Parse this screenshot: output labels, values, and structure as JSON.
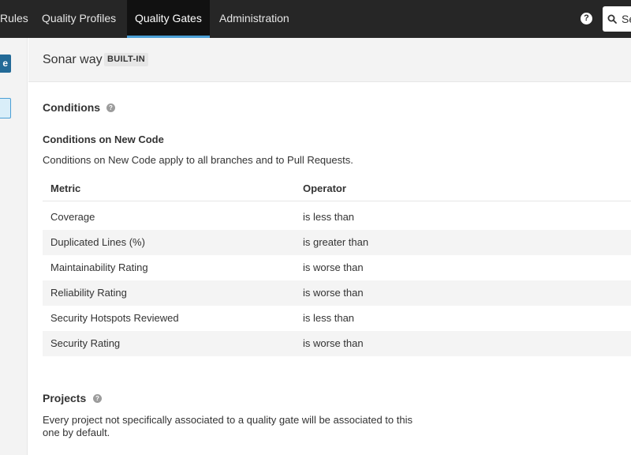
{
  "nav": {
    "items": [
      "Rules",
      "Quality Profiles",
      "Quality Gates",
      "Administration"
    ],
    "help_icon": "?",
    "search_text": "Se"
  },
  "sidebar": {
    "button_label": "e"
  },
  "header": {
    "gate_name": "Sonar way",
    "badge": "BUILT-IN"
  },
  "conditions": {
    "title": "Conditions",
    "help_icon": "?",
    "new_code_title": "Conditions on New Code",
    "new_code_desc": "Conditions on New Code apply to all branches and to Pull Requests.",
    "columns": [
      "Metric",
      "Operator"
    ],
    "rows": [
      {
        "metric": "Coverage",
        "operator": "is less than"
      },
      {
        "metric": "Duplicated Lines (%)",
        "operator": "is greater than"
      },
      {
        "metric": "Maintainability Rating",
        "operator": "is worse than"
      },
      {
        "metric": "Reliability Rating",
        "operator": "is worse than"
      },
      {
        "metric": "Security Hotspots Reviewed",
        "operator": "is less than"
      },
      {
        "metric": "Security Rating",
        "operator": "is worse than"
      }
    ]
  },
  "projects": {
    "title": "Projects",
    "help_icon": "?",
    "desc_line1": "Every project not specifically associated to a quality gate will be associated to this",
    "desc_line2": "one by default."
  },
  "colors": {
    "nav_bg": "#262626",
    "active_tab_underline": "#4b9fd5",
    "primary_button": "#236a97"
  }
}
